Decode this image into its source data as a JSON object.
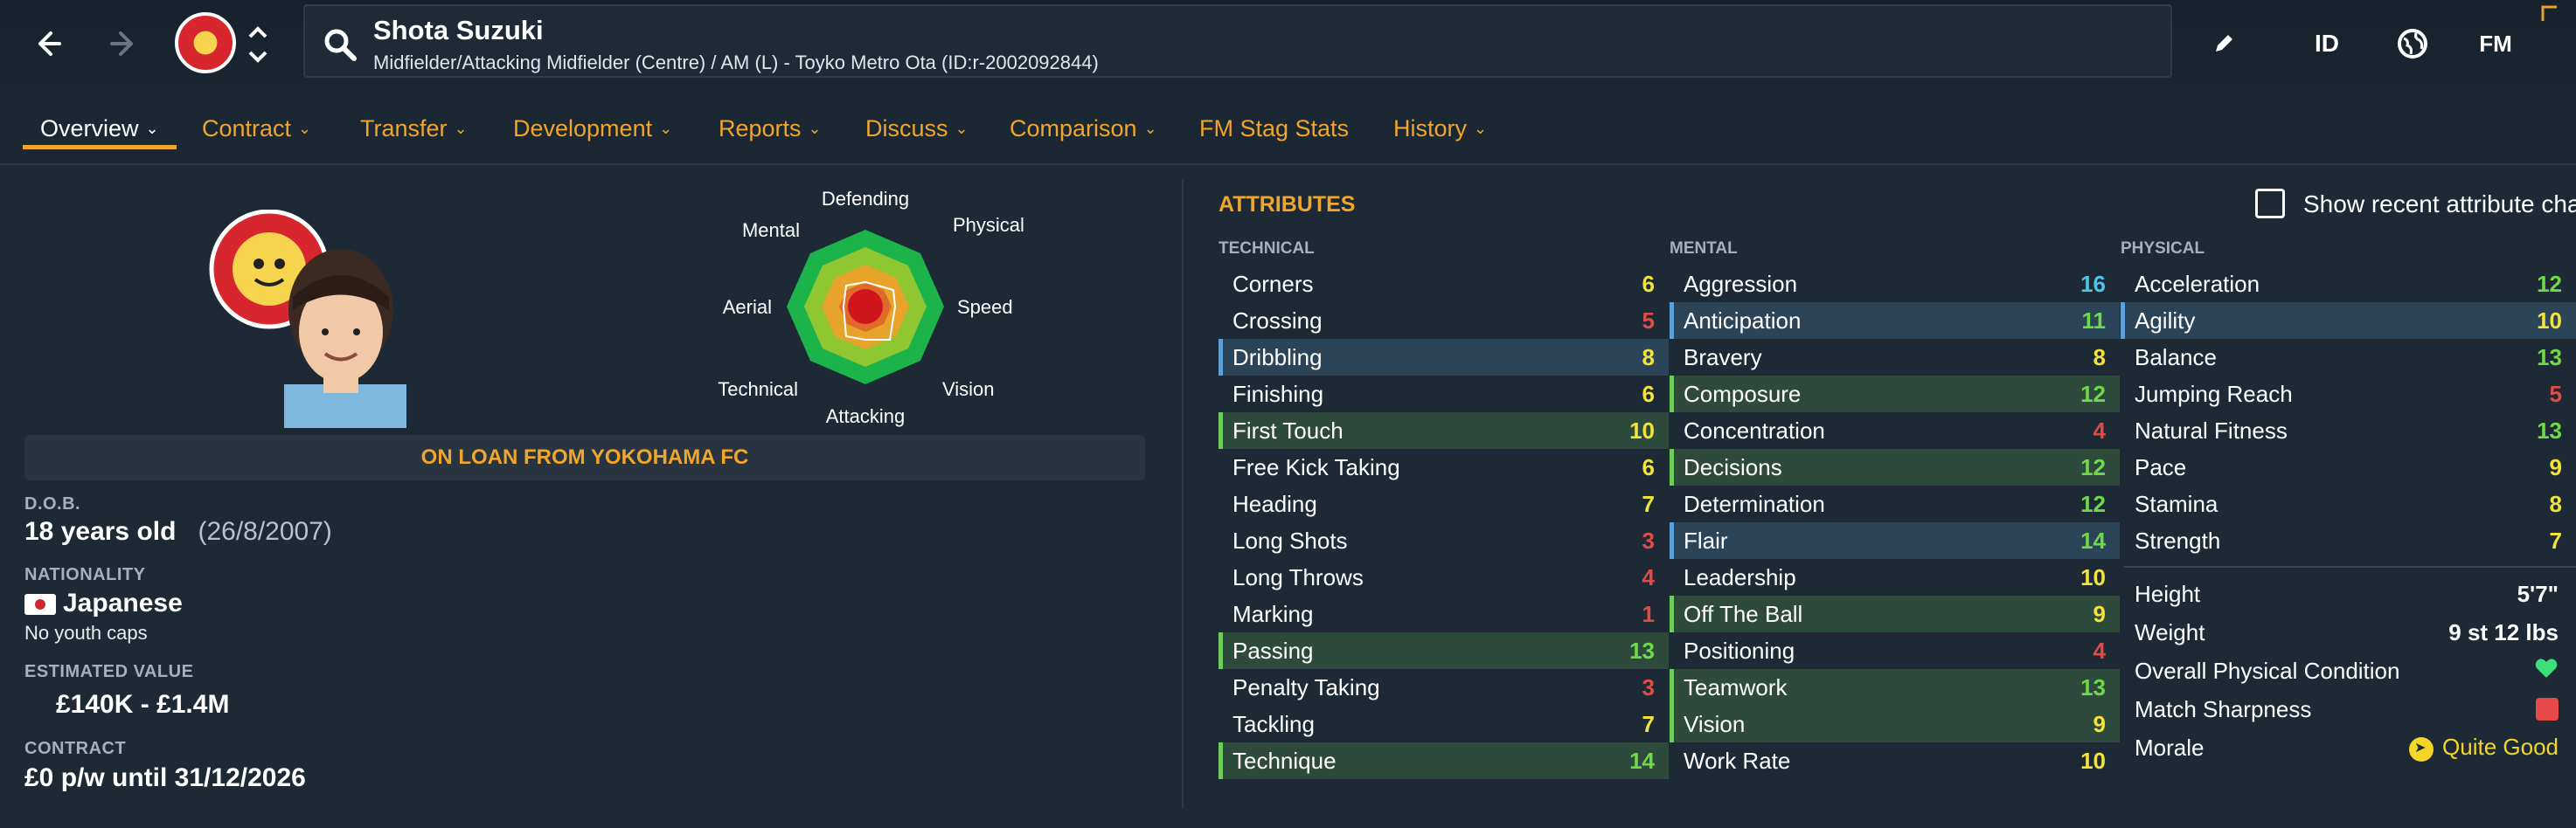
{
  "header": {
    "player_name": "Shota Suzuki",
    "player_subtitle": "Midfielder/Attacking Midfielder (Centre) / AM (L) - Toyko Metro Ota (ID:r-2002092844)",
    "id_label": "ID",
    "fm_label": "FM",
    "icons": [
      "back-arrow-icon",
      "forward-arrow-icon",
      "club-badge",
      "up-down-chevron-icon",
      "search-icon",
      "edit-pencil-icon",
      "globe-icon"
    ]
  },
  "tabs": [
    {
      "label": "Overview",
      "active": true
    },
    {
      "label": "Contract"
    },
    {
      "label": "Transfer"
    },
    {
      "label": "Development"
    },
    {
      "label": "Reports"
    },
    {
      "label": "Discuss"
    },
    {
      "label": "Comparison"
    },
    {
      "label": "FM Stag Stats"
    },
    {
      "label": "History"
    }
  ],
  "radar": {
    "labels": {
      "defending": "Defending",
      "physical": "Physical",
      "speed": "Speed",
      "vision": "Vision",
      "attacking": "Attacking",
      "technical": "Technical",
      "aerial": "Aerial",
      "mental": "Mental"
    }
  },
  "overview": {
    "loan_banner": "ON LOAN FROM YOKOHAMA FC",
    "dob_label": "D.O.B.",
    "age": "18 years old",
    "dob": "(26/8/2007)",
    "nationality_label": "NATIONALITY",
    "nationality": "Japanese",
    "youth_caps": "No youth caps",
    "value_label": "ESTIMATED VALUE",
    "value": "£140K - £1.4M",
    "contract_label": "CONTRACT",
    "contract": "£0 p/w until 31/12/2026"
  },
  "attributes": {
    "title": "ATTRIBUTES",
    "show_recent_label": "Show recent attribute cha",
    "technical_title": "TECHNICAL",
    "mental_title": "MENTAL",
    "physical_title": "PHYSICAL",
    "technical": [
      {
        "name": "Corners",
        "value": "6",
        "color": "yellow",
        "hl": ""
      },
      {
        "name": "Crossing",
        "value": "5",
        "color": "red",
        "hl": ""
      },
      {
        "name": "Dribbling",
        "value": "8",
        "color": "yellow",
        "hl": "blue"
      },
      {
        "name": "Finishing",
        "value": "6",
        "color": "yellow",
        "hl": ""
      },
      {
        "name": "First Touch",
        "value": "10",
        "color": "yellow",
        "hl": "green"
      },
      {
        "name": "Free Kick Taking",
        "value": "6",
        "color": "yellow",
        "hl": ""
      },
      {
        "name": "Heading",
        "value": "7",
        "color": "yellow",
        "hl": ""
      },
      {
        "name": "Long Shots",
        "value": "3",
        "color": "red",
        "hl": ""
      },
      {
        "name": "Long Throws",
        "value": "4",
        "color": "red",
        "hl": ""
      },
      {
        "name": "Marking",
        "value": "1",
        "color": "red",
        "hl": ""
      },
      {
        "name": "Passing",
        "value": "13",
        "color": "green",
        "hl": "green"
      },
      {
        "name": "Penalty Taking",
        "value": "3",
        "color": "red",
        "hl": ""
      },
      {
        "name": "Tackling",
        "value": "7",
        "color": "yellow",
        "hl": ""
      },
      {
        "name": "Technique",
        "value": "14",
        "color": "green",
        "hl": "green"
      }
    ],
    "mental": [
      {
        "name": "Aggression",
        "value": "16",
        "color": "blue",
        "hl": ""
      },
      {
        "name": "Anticipation",
        "value": "11",
        "color": "green",
        "hl": "blue"
      },
      {
        "name": "Bravery",
        "value": "8",
        "color": "yellow",
        "hl": ""
      },
      {
        "name": "Composure",
        "value": "12",
        "color": "green",
        "hl": "green"
      },
      {
        "name": "Concentration",
        "value": "4",
        "color": "red",
        "hl": ""
      },
      {
        "name": "Decisions",
        "value": "12",
        "color": "green",
        "hl": "green"
      },
      {
        "name": "Determination",
        "value": "12",
        "color": "green",
        "hl": ""
      },
      {
        "name": "Flair",
        "value": "14",
        "color": "green",
        "hl": "blue"
      },
      {
        "name": "Leadership",
        "value": "10",
        "color": "yellow",
        "hl": ""
      },
      {
        "name": "Off The Ball",
        "value": "9",
        "color": "yellow",
        "hl": "green"
      },
      {
        "name": "Positioning",
        "value": "4",
        "color": "red",
        "hl": ""
      },
      {
        "name": "Teamwork",
        "value": "13",
        "color": "green",
        "hl": "green"
      },
      {
        "name": "Vision",
        "value": "9",
        "color": "yellow",
        "hl": "green"
      },
      {
        "name": "Work Rate",
        "value": "10",
        "color": "yellow",
        "hl": ""
      }
    ],
    "physical": [
      {
        "name": "Acceleration",
        "value": "12",
        "color": "green",
        "hl": ""
      },
      {
        "name": "Agility",
        "value": "10",
        "color": "yellow",
        "hl": "blue"
      },
      {
        "name": "Balance",
        "value": "13",
        "color": "green",
        "hl": ""
      },
      {
        "name": "Jumping Reach",
        "value": "5",
        "color": "red",
        "hl": ""
      },
      {
        "name": "Natural Fitness",
        "value": "13",
        "color": "green",
        "hl": ""
      },
      {
        "name": "Pace",
        "value": "9",
        "color": "yellow",
        "hl": ""
      },
      {
        "name": "Stamina",
        "value": "8",
        "color": "yellow",
        "hl": ""
      },
      {
        "name": "Strength",
        "value": "7",
        "color": "yellow",
        "hl": ""
      }
    ],
    "physical_extra": {
      "height_label": "Height",
      "height": "5'7\"",
      "weight_label": "Weight",
      "weight": "9 st 12 lbs",
      "condition_label": "Overall Physical Condition",
      "sharpness_label": "Match Sharpness",
      "morale_label": "Morale",
      "morale": "Quite Good"
    }
  },
  "colors": {
    "accent": "#f0a52c",
    "red": "#e04b45",
    "yellow": "#f1e23d",
    "green": "#6fd84b",
    "blue": "#4fc3e8"
  }
}
